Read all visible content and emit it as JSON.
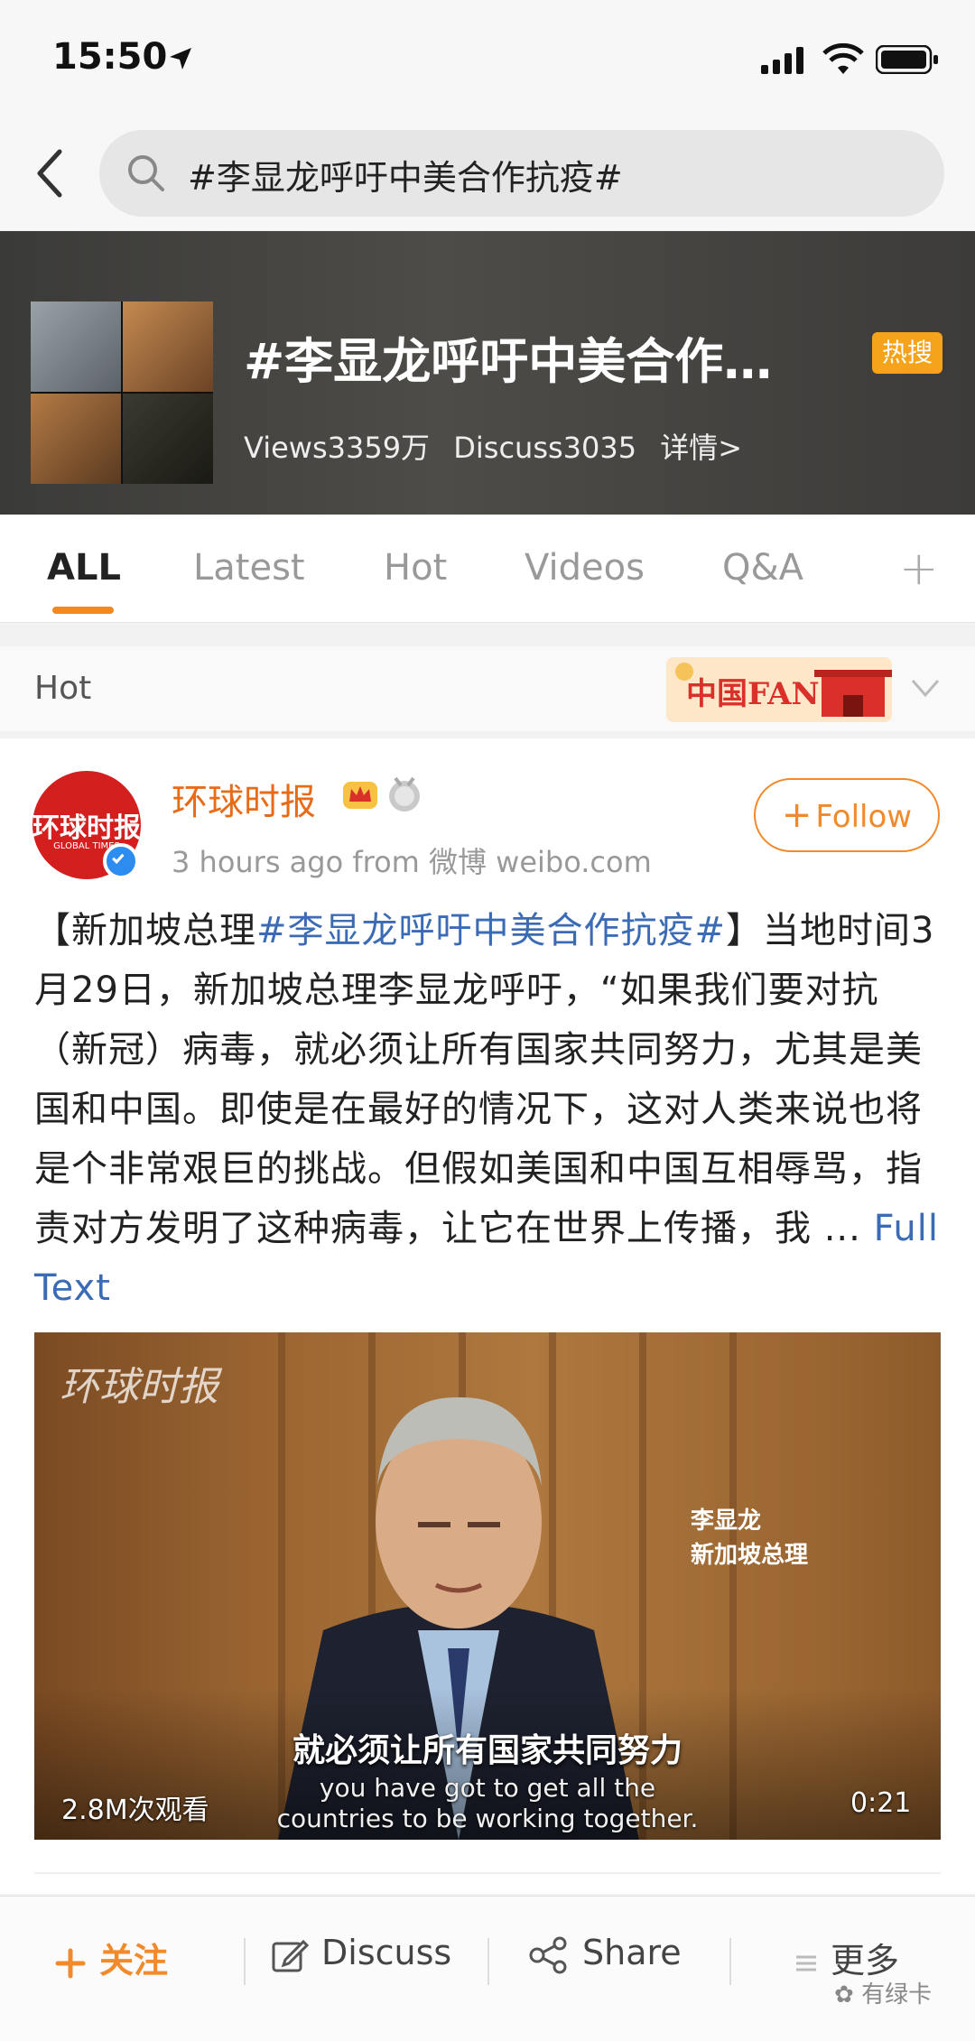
{
  "status": {
    "time": "15:50"
  },
  "search": {
    "query": "#李显龙呼吁中美合作抗疫#"
  },
  "topic": {
    "title": "#李显龙呼吁中美合作…",
    "badge": "热搜",
    "views": "Views3359万",
    "discuss": "Discuss3035",
    "details": "详情>"
  },
  "tabs": [
    {
      "label": "ALL"
    },
    {
      "label": "Latest"
    },
    {
      "label": "Hot"
    },
    {
      "label": "Videos"
    },
    {
      "label": "Q&A"
    }
  ],
  "section": {
    "label": "Hot",
    "banner_text": "中国FANS"
  },
  "post": {
    "author": "环球时报",
    "avatar_text": "环球时报",
    "avatar_sub": "GLOBAL TIMES",
    "meta": "3 hours ago  from 微博 weibo.com",
    "follow_label": "Follow",
    "body_prefix": "【新加坡总理",
    "body_hashtag": "#李显龙呼吁中美合作抗疫#",
    "body_text": "】当地时间3月29日，新加坡总理李显龙呼吁，“如果我们要对抗（新冠）病毒，就必须让所有国家共同努力，尤其是美国和中国。即使是在最好的情况下，这对人类来说也将是个非常艰巨的挑战。但假如美国和中国互相辱骂，指责对方发明了这种病毒，让它在世界上传播，我 ... ",
    "full_text_label": "Full Text",
    "video": {
      "watermark": "环球时报",
      "name_line1": "李显龙",
      "name_line2": "新加坡总理",
      "subtitle_cn": "就必须让所有国家共同努力",
      "subtitle_en_1": "you have got to get all the",
      "subtitle_en_2": "countries to be working together.",
      "views": "2.8M次观看",
      "duration": "0:21"
    }
  },
  "bottom_bar": {
    "follow": "关注",
    "discuss": "Discuss",
    "share": "Share",
    "more": "更多",
    "watermark": "有绿卡"
  },
  "colors": {
    "accent": "#f08a2c",
    "link": "#3b6bb5",
    "hot_badge": "#f4a31a"
  }
}
